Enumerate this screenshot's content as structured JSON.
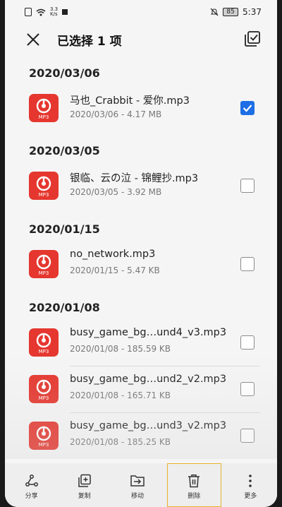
{
  "status": {
    "speed_top": "3.3",
    "speed_bottom": "K/s",
    "battery": "85",
    "time": "5:37"
  },
  "header": {
    "title": "已选择 1 项"
  },
  "groups": [
    {
      "date": "2020/03/06",
      "files": [
        {
          "name": "马也_Crabbit - 爱你.mp3",
          "meta": "2020/03/06 - 4.17 MB",
          "checked": true
        }
      ]
    },
    {
      "date": "2020/03/05",
      "files": [
        {
          "name": "银临、云の泣 - 锦鲤抄.mp3",
          "meta": "2020/03/05 - 3.92 MB",
          "checked": false
        }
      ]
    },
    {
      "date": "2020/01/15",
      "files": [
        {
          "name": "no_network.mp3",
          "meta": "2020/01/15 - 5.47 KB",
          "checked": false
        }
      ]
    },
    {
      "date": "2020/01/08",
      "files": [
        {
          "name": "busy_game_bg…und4_v3.mp3",
          "meta": "2020/01/08 - 185.59 KB",
          "checked": false
        },
        {
          "name": "busy_game_bg…und2_v2.mp3",
          "meta": "2020/01/08 - 165.71 KB",
          "checked": false
        },
        {
          "name": "busy_game_bg…und3_v2.mp3",
          "meta": "2020/01/08 - 185.25 KB",
          "checked": false
        }
      ]
    }
  ],
  "file_icon_label": "MP3",
  "bottom_bar": [
    {
      "label": "分享",
      "icon": "share-icon"
    },
    {
      "label": "复制",
      "icon": "copy-icon"
    },
    {
      "label": "移动",
      "icon": "move-icon"
    },
    {
      "label": "删除",
      "icon": "delete-icon"
    },
    {
      "label": "更多",
      "icon": "more-icon"
    }
  ],
  "colors": {
    "accent": "#1e6ee6",
    "mp3_red": "#e5372f",
    "highlight": "#e5b22a"
  }
}
